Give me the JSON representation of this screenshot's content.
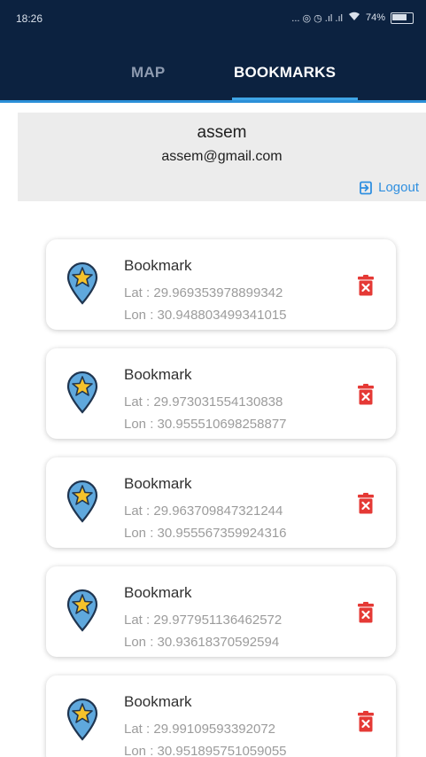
{
  "status_bar": {
    "time": "18:26",
    "icons_text": "... ◎ ◷ .ıl .ıl",
    "battery_percent": "74%"
  },
  "tabs": [
    {
      "label": "MAP",
      "active": false
    },
    {
      "label": "BOOKMARKS",
      "active": true
    }
  ],
  "user": {
    "name": "assem",
    "email": "assem@gmail.com",
    "logout_label": "Logout"
  },
  "bookmarks": [
    {
      "title": "Bookmark",
      "lat": "Lat : 29.969353978899342",
      "lon": "Lon : 30.948803499341015"
    },
    {
      "title": "Bookmark",
      "lat": "Lat : 29.973031554130838",
      "lon": "Lon : 30.955510698258877"
    },
    {
      "title": "Bookmark",
      "lat": "Lat : 29.963709847321244",
      "lon": "Lon : 30.955567359924316"
    },
    {
      "title": "Bookmark",
      "lat": "Lat : 29.977951136462572",
      "lon": "Lon : 30.93618370592594"
    },
    {
      "title": "Bookmark",
      "lat": "Lat : 29.99109593392072",
      "lon": "Lon : 30.951895751059055"
    }
  ],
  "colors": {
    "header": "#0c2240",
    "accent": "#3fa5e6",
    "delete": "#e53935",
    "pin": "#5fa8dd",
    "star": "#f5c22b"
  },
  "icons": {
    "logout": "logout-icon",
    "pin": "map-pin-star-icon",
    "delete": "trash-icon"
  }
}
